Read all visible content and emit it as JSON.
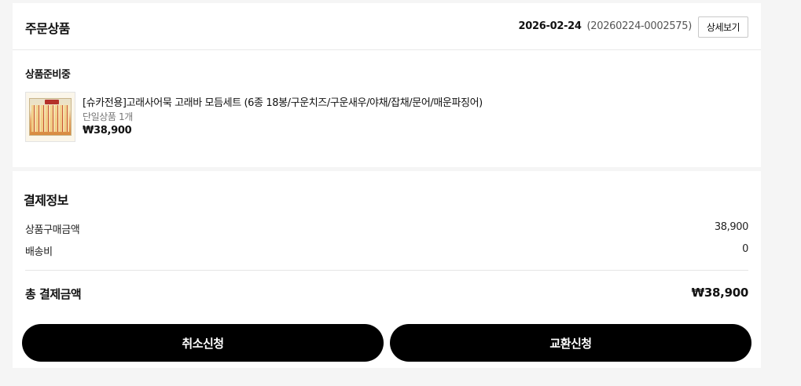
{
  "order": {
    "title": "주문상품",
    "date": "2026-02-24",
    "number": "(20260224-0002575)",
    "detail_button": "상세보기",
    "status": "상품준비중",
    "product": {
      "name": "[슈카전용]고래사어묵 고래바 모듬세트 (6종 18봉/구운치즈/구운새우/야채/잡채/문어/매운파징어)",
      "option": "단일상품 1개",
      "price": "₩38,900"
    }
  },
  "payment": {
    "title": "결제정보",
    "rows": [
      {
        "label": "상품구매금액",
        "value": "38,900"
      },
      {
        "label": "배송비",
        "value": "0"
      }
    ],
    "total_label": "총 결제금액",
    "total_value": "₩38,900"
  },
  "actions": {
    "cancel": "취소신청",
    "exchange": "교환신청"
  }
}
